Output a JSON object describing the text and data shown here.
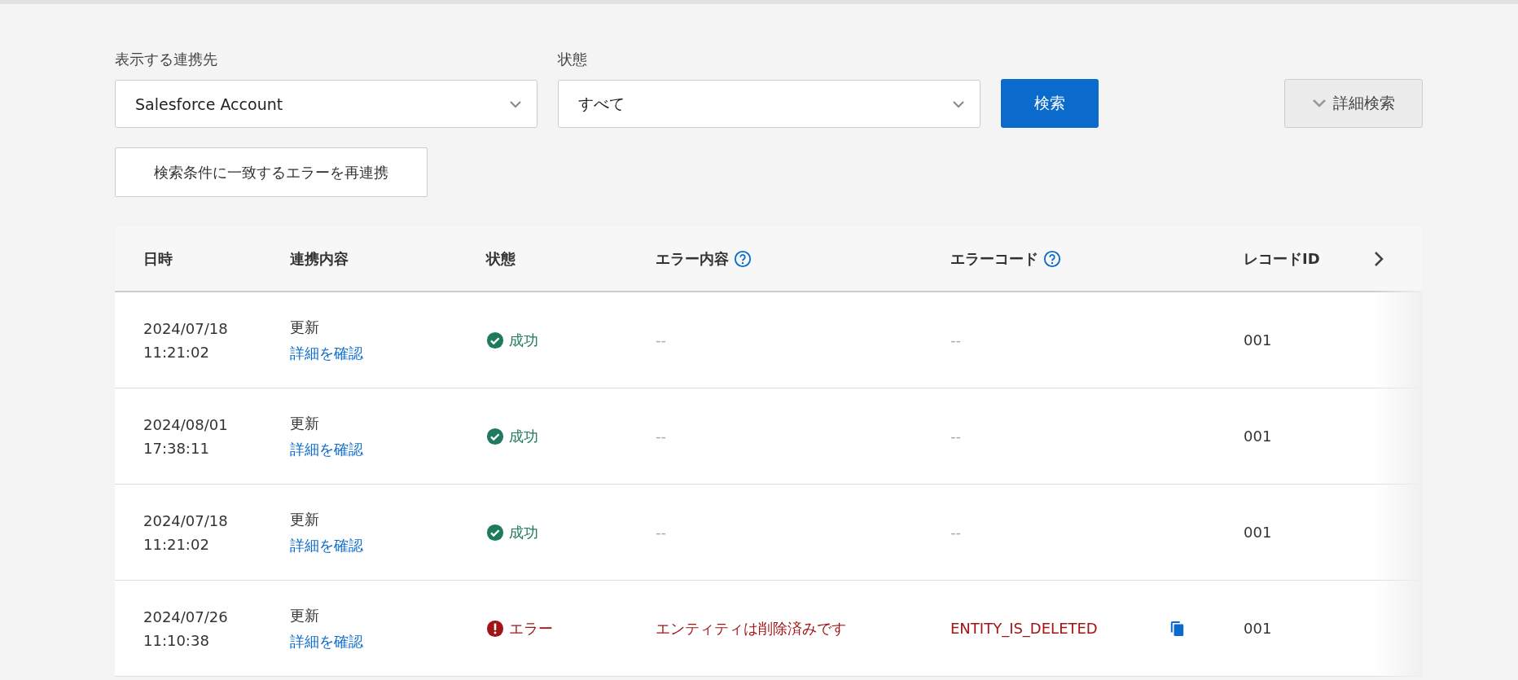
{
  "filters": {
    "target": {
      "label": "表示する連携先",
      "value": "Salesforce Account"
    },
    "status": {
      "label": "状態",
      "value": "すべて"
    },
    "search_button": "検索",
    "advanced_search": {
      "label": "詳細検索",
      "expanded": false
    },
    "resync_button": "検索条件に一致するエラーを再連携"
  },
  "table": {
    "columns": [
      {
        "label": "日時",
        "help": false
      },
      {
        "label": "連携内容",
        "help": false
      },
      {
        "label": "状態",
        "help": false
      },
      {
        "label": "エラー内容",
        "help": true
      },
      {
        "label": "エラーコード",
        "help": true
      },
      {
        "label": "レコードID",
        "help": false
      }
    ],
    "rows": [
      {
        "date": "2024/07/18",
        "time": "11:21:02",
        "action": "更新",
        "link": "詳細を確認",
        "status": {
          "kind": "success",
          "label": "成功"
        },
        "error": "--",
        "code": "--",
        "copy": false,
        "record_id": "001"
      },
      {
        "date": "2024/08/01",
        "time": "17:38:11",
        "action": "更新",
        "link": "詳細を確認",
        "status": {
          "kind": "success",
          "label": "成功"
        },
        "error": "--",
        "code": "--",
        "copy": false,
        "record_id": "001"
      },
      {
        "date": "2024/07/18",
        "time": "11:21:02",
        "action": "更新",
        "link": "詳細を確認",
        "status": {
          "kind": "success",
          "label": "成功"
        },
        "error": "--",
        "code": "--",
        "copy": false,
        "record_id": "001"
      },
      {
        "date": "2024/07/26",
        "time": "11:10:38",
        "action": "更新",
        "link": "詳細を確認",
        "status": {
          "kind": "error",
          "label": "エラー"
        },
        "error": "エンティティは削除済みです",
        "code": "ENTITY_IS_DELETED",
        "copy": true,
        "record_id": "001"
      }
    ]
  }
}
